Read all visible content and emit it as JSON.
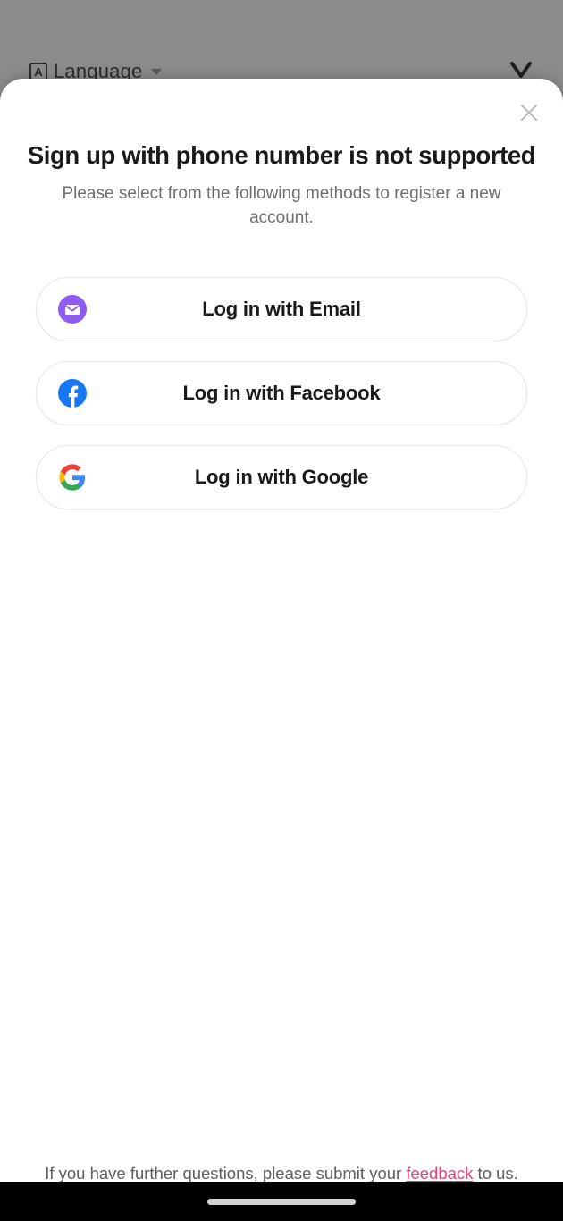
{
  "background": {
    "language_selector": {
      "icon": "language-a-icon",
      "label": "Language",
      "caret": "chevron-down-icon"
    },
    "close_button": {
      "icon": "close-icon"
    },
    "overlay_color": "#8b8b8b"
  },
  "modal": {
    "close_button": {
      "icon": "close-icon"
    },
    "title": "Sign up with phone number is not supported",
    "subtitle": "Please select from the following methods to register a new account.",
    "providers": [
      {
        "icon": "email-icon",
        "label": "Log in with Email",
        "color": "#8f5cf0"
      },
      {
        "icon": "facebook-icon",
        "label": "Log in with Facebook",
        "color": "#1877f2"
      },
      {
        "icon": "google-icon",
        "label": "Log in with Google",
        "color": "#4285f4"
      }
    ],
    "footer": {
      "text_before": "If you have further questions, please submit your ",
      "link_text": "feedback",
      "text_after": " to us.",
      "link_color": "#e5407a"
    }
  },
  "system": {
    "home_indicator": "home-indicator"
  }
}
